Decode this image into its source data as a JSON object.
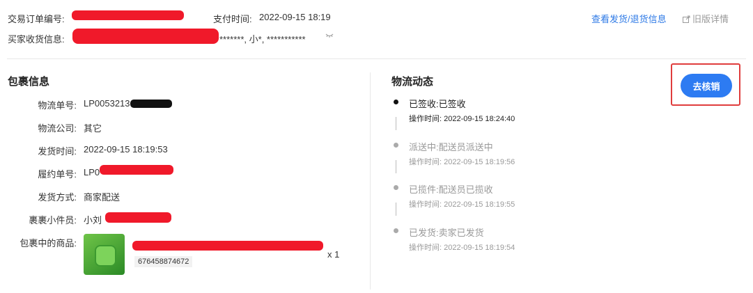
{
  "header": {
    "order_no_label": "交易订单编号:",
    "pay_time_label": "支付时间:",
    "pay_time_value": "2022-09-15 18:19",
    "view_shipping_link": "查看发货/退货信息",
    "old_detail_link": "旧版详情",
    "buyer_info_label": "买家收货信息:",
    "buyer_info_masked": "*******, 小*, ***********"
  },
  "package": {
    "title": "包裹信息",
    "rows": [
      {
        "label": "物流单号:",
        "value": "LP0053213"
      },
      {
        "label": "物流公司:",
        "value": "其它"
      },
      {
        "label": "发货时间:",
        "value": "2022-09-15 18:19:53"
      },
      {
        "label": "履约单号:",
        "value": "LP0"
      },
      {
        "label": "发货方式:",
        "value": "商家配送"
      },
      {
        "label": "裹裹小件员:",
        "value": "小刘"
      }
    ],
    "goods_label": "包裹中的商品:",
    "goods_sku": "676458874672",
    "goods_qty": "x 1"
  },
  "logistics": {
    "title": "物流动态",
    "events": [
      {
        "title": "已签收:已签收",
        "time": "操作时间: 2022-09-15 18:24:40",
        "active": true
      },
      {
        "title": "派送中:配送员派送中",
        "time": "操作时间: 2022-09-15 18:19:56",
        "active": false
      },
      {
        "title": "已揽件:配送员已揽收",
        "time": "操作时间: 2022-09-15 18:19:55",
        "active": false
      },
      {
        "title": "已发货:卖家已发货",
        "time": "操作时间: 2022-09-15 18:19:54",
        "active": false
      }
    ]
  },
  "actions": {
    "verify_button": "去核销"
  },
  "colors": {
    "accent": "#2d7bf2",
    "redaction": "#f0192a",
    "highlight_border": "#e03c3c"
  }
}
